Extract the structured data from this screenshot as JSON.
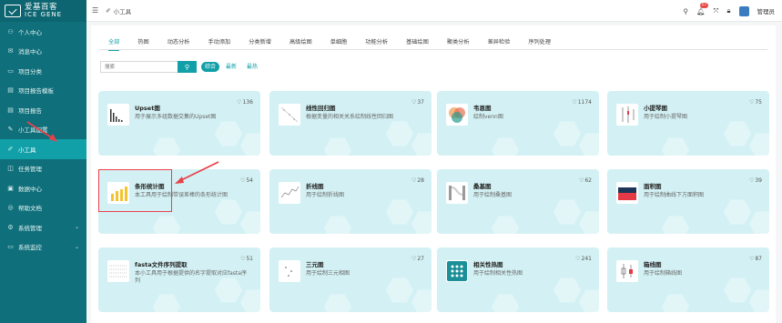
{
  "brand": {
    "name": "爱基百客",
    "sub": "ICE GENE"
  },
  "sidebar": {
    "items": [
      {
        "label": "个人中心",
        "icon": "user-icon",
        "glyph": "⚇"
      },
      {
        "label": "消息中心",
        "icon": "message-icon",
        "glyph": "✉"
      },
      {
        "label": "项目分类",
        "icon": "folder-icon",
        "glyph": "▭"
      },
      {
        "label": "项目报告模板",
        "icon": "document-icon",
        "glyph": "▤"
      },
      {
        "label": "项目报告",
        "icon": "document-icon",
        "glyph": "▤"
      },
      {
        "label": "小工具配置",
        "icon": "edit-icon",
        "glyph": "✎"
      },
      {
        "label": "小工具",
        "icon": "tool-icon",
        "glyph": "✐",
        "active": true
      },
      {
        "label": "任务管理",
        "icon": "task-icon",
        "glyph": "◫"
      },
      {
        "label": "数据中心",
        "icon": "data-icon",
        "glyph": "▣"
      },
      {
        "label": "帮助文档",
        "icon": "help-icon",
        "glyph": "◎"
      },
      {
        "label": "系统管理",
        "icon": "gear-icon",
        "glyph": "⚙",
        "chevron": "⌄"
      },
      {
        "label": "系统监控",
        "icon": "monitor-icon",
        "glyph": "▭",
        "chevron": "⌄"
      }
    ]
  },
  "header": {
    "breadcrumb": "小工具",
    "user": "管理员",
    "notification_count": "17"
  },
  "tabs": [
    "全部",
    "热图",
    "动态分析",
    "手动添加",
    "分类新增",
    "高级绘图",
    "单细胞",
    "功能分析",
    "基础绘图",
    "聚类分析",
    "差异检验",
    "序列处理"
  ],
  "search": {
    "placeholder": "搜索"
  },
  "sort": [
    "综合",
    "最新",
    "最热"
  ],
  "cards": [
    {
      "title": "Upset图",
      "desc": "用于展示多组数据交集的Upset图",
      "likes": "136"
    },
    {
      "title": "线性回归图",
      "desc": "根据变量的相关关系绘制线性回归图",
      "likes": "37"
    },
    {
      "title": "韦恩图",
      "desc": "绘制venn图",
      "likes": "1174"
    },
    {
      "title": "小提琴图",
      "desc": "用于绘制小提琴图",
      "likes": "75"
    },
    {
      "title": "条形统计图",
      "desc": "本工具用于绘制带误差棒的条形统计图",
      "likes": "54"
    },
    {
      "title": "折线图",
      "desc": "用于绘制折线图",
      "likes": "28"
    },
    {
      "title": "桑基图",
      "desc": "用于绘制桑基图",
      "likes": "62"
    },
    {
      "title": "面积图",
      "desc": "用于绘制曲线下方面积图",
      "likes": "39"
    },
    {
      "title": "fasta文件序列提取",
      "desc": "本小工具用于根据提供的名字提取对应fasta序列",
      "likes": "51"
    },
    {
      "title": "三元图",
      "desc": "用于绘制三元相图",
      "likes": "27"
    },
    {
      "title": "相关性热图",
      "desc": "用于绘制相关性热图",
      "likes": "241"
    },
    {
      "title": "箱线图",
      "desc": "用于绘制箱线图",
      "likes": "87"
    }
  ],
  "colors": {
    "sidebar": "#0f6f7a",
    "accent": "#12a0a8",
    "card_bg": "#d3f1f4",
    "highlight": "#e8414b"
  }
}
